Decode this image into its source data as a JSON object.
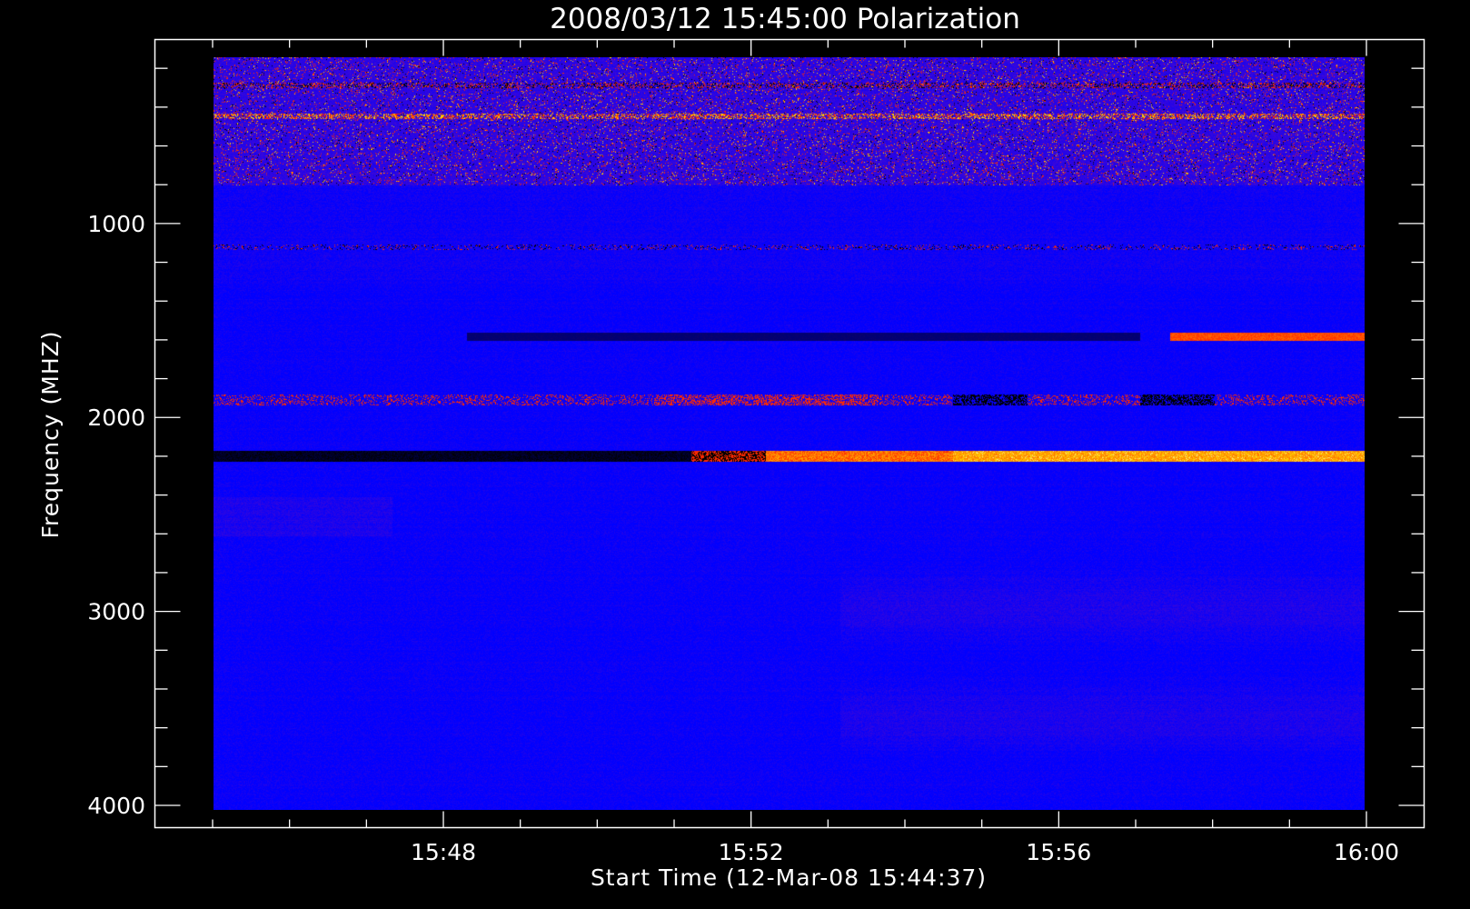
{
  "chart_data": {
    "type": "heatmap",
    "title": "2008/03/12 15:45:00 Polarization",
    "xlabel": "Start Time (12-Mar-08 15:44:37)",
    "ylabel": "Frequency (MHZ)",
    "x_ticks": [
      {
        "minutes": 3,
        "label": "15:48"
      },
      {
        "minutes": 7,
        "label": "15:52"
      },
      {
        "minutes": 11,
        "label": "15:56"
      },
      {
        "minutes": 15,
        "label": "16:00"
      }
    ],
    "y_ticks": [
      {
        "value": 1000,
        "label": "1000"
      },
      {
        "value": 2000,
        "label": "2000"
      },
      {
        "value": 3000,
        "label": "3000"
      },
      {
        "value": 4000,
        "label": "4000"
      }
    ],
    "xlim_minutes_after_1545": [
      -0.75,
      15.75
    ],
    "ylim_mhz": [
      0,
      4100
    ],
    "colormap": [
      "#000000",
      "#1a1aff",
      "#0000ff",
      "#7a10b0",
      "#ff2a00",
      "#ffd000",
      "#ffffff"
    ],
    "features": [
      {
        "name": "broadband polarized band",
        "freq_mhz": [
          2160,
          2210
        ],
        "start": "15:44:37",
        "end": "16:00",
        "polarity_change": "dark before ~15:51, bright after ~15:51"
      },
      {
        "name": "narrowband feature",
        "freq_mhz": [
          1560,
          1590
        ],
        "start": "15:57:30",
        "end": "16:00",
        "intensity": "bright"
      },
      {
        "name": "narrowband feature",
        "freq_mhz": [
          1870,
          1920
        ],
        "start": "15:44:37",
        "end": "16:00",
        "intensity": "mixed"
      },
      {
        "name": "RFI lines",
        "freq_mhz": [
          150,
          780
        ],
        "start": "15:44:37",
        "end": "16:00",
        "intensity": "speckled"
      }
    ]
  }
}
